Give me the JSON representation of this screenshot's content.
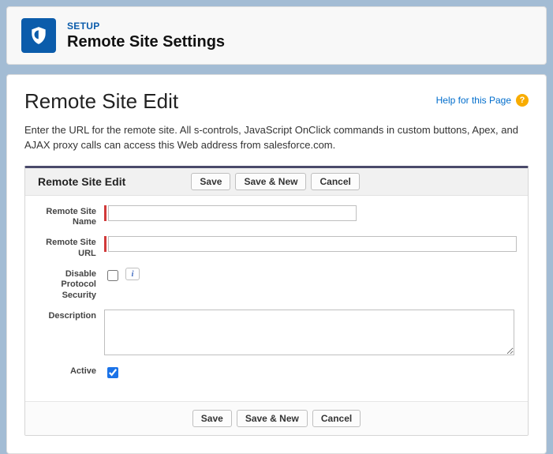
{
  "header": {
    "eyebrow": "SETUP",
    "title": "Remote Site Settings"
  },
  "page": {
    "title": "Remote Site Edit",
    "help_label": "Help for this Page",
    "intro": "Enter the URL for the remote site. All s-controls, JavaScript OnClick commands in custom buttons, Apex, and AJAX proxy calls can access this Web address from salesforce.com."
  },
  "panel": {
    "title": "Remote Site Edit",
    "buttons": {
      "save": "Save",
      "save_new": "Save & New",
      "cancel": "Cancel"
    }
  },
  "fields": {
    "remote_site_name": {
      "label": "Remote Site Name",
      "value": ""
    },
    "remote_site_url": {
      "label": "Remote Site URL",
      "value": ""
    },
    "disable_protocol_security": {
      "label": "Disable Protocol Security",
      "checked": false
    },
    "description": {
      "label": "Description",
      "value": ""
    },
    "active": {
      "label": "Active",
      "checked": true
    }
  }
}
